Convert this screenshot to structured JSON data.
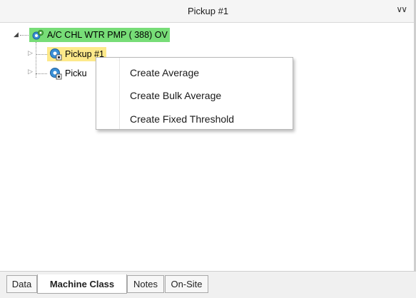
{
  "header": {
    "title": "Pickup #1",
    "collapse_icon": "double-chevron-down-icon"
  },
  "tree": {
    "root": {
      "label": "A/C CHL WTR PMP ( 388) OV",
      "icon": "machine-icon",
      "expander": "expanded-triangle-icon",
      "highlight_color": "#77dd77"
    },
    "children": [
      {
        "label": "Pickup #1",
        "icon": "pickup-sensor-icon",
        "expander": "collapsed-triangle-icon",
        "selected": true,
        "highlight_color": "#fde98a"
      },
      {
        "label": "Picku",
        "icon": "pickup-sensor-icon",
        "expander": "collapsed-triangle-icon",
        "selected": false
      }
    ]
  },
  "context_menu": {
    "items": [
      {
        "label": "Create Average"
      },
      {
        "label": "Create Bulk Average"
      },
      {
        "label": "Create Fixed Threshold"
      }
    ]
  },
  "tabs": [
    {
      "label": "Data",
      "active": false
    },
    {
      "label": "Machine Class",
      "active": true
    },
    {
      "label": "Notes",
      "active": false
    },
    {
      "label": "On-Site",
      "active": false
    }
  ]
}
